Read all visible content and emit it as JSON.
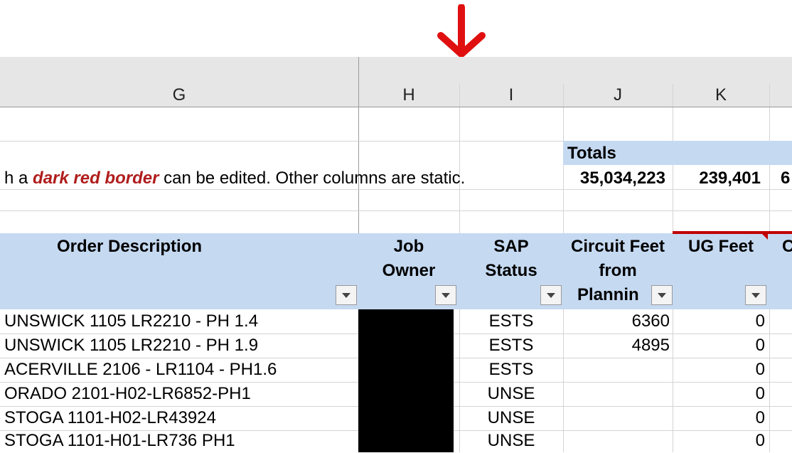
{
  "columns": [
    "G",
    "H",
    "I",
    "J",
    "K"
  ],
  "totals": {
    "label": "Totals",
    "values": [
      "35,034,223",
      "239,401",
      "6"
    ]
  },
  "note": {
    "prefix": "h a ",
    "highlight": "dark red border",
    "suffix": " can be edited. Other columns are static."
  },
  "headers": {
    "order_description": "Order Description",
    "job_owner": [
      "Job",
      "Owner"
    ],
    "sap_status": [
      "SAP",
      "Status"
    ],
    "circuit_feet": [
      "Circuit Feet",
      "from",
      "Plannin"
    ],
    "ug_feet": "UG Feet",
    "next_col_partial": "C"
  },
  "rows": [
    {
      "desc": "UNSWICK 1105 LR2210 - PH 1.4",
      "status": "ESTS",
      "circuit": "6360",
      "ug": "0"
    },
    {
      "desc": "UNSWICK 1105 LR2210 - PH 1.9",
      "status": "ESTS",
      "circuit": "4895",
      "ug": "0"
    },
    {
      "desc": "ACERVILLE 2106 - LR1104 - PH1.6",
      "status": "ESTS",
      "circuit": "",
      "ug": "0"
    },
    {
      "desc": "ORADO 2101-H02-LR6852-PH1",
      "status": "UNSE",
      "circuit": "",
      "ug": "0"
    },
    {
      "desc": "STOGA 1101-H02-LR43924",
      "status": "UNSE",
      "circuit": "",
      "ug": "0"
    },
    {
      "desc": "STOGA 1101-H01-LR736 PH1",
      "status": "UNSE",
      "circuit": "",
      "ug": "0"
    }
  ],
  "colors": {
    "arrow": "#e01010",
    "header_fill": "#c5d9f1",
    "editable_border": "#c00000"
  }
}
